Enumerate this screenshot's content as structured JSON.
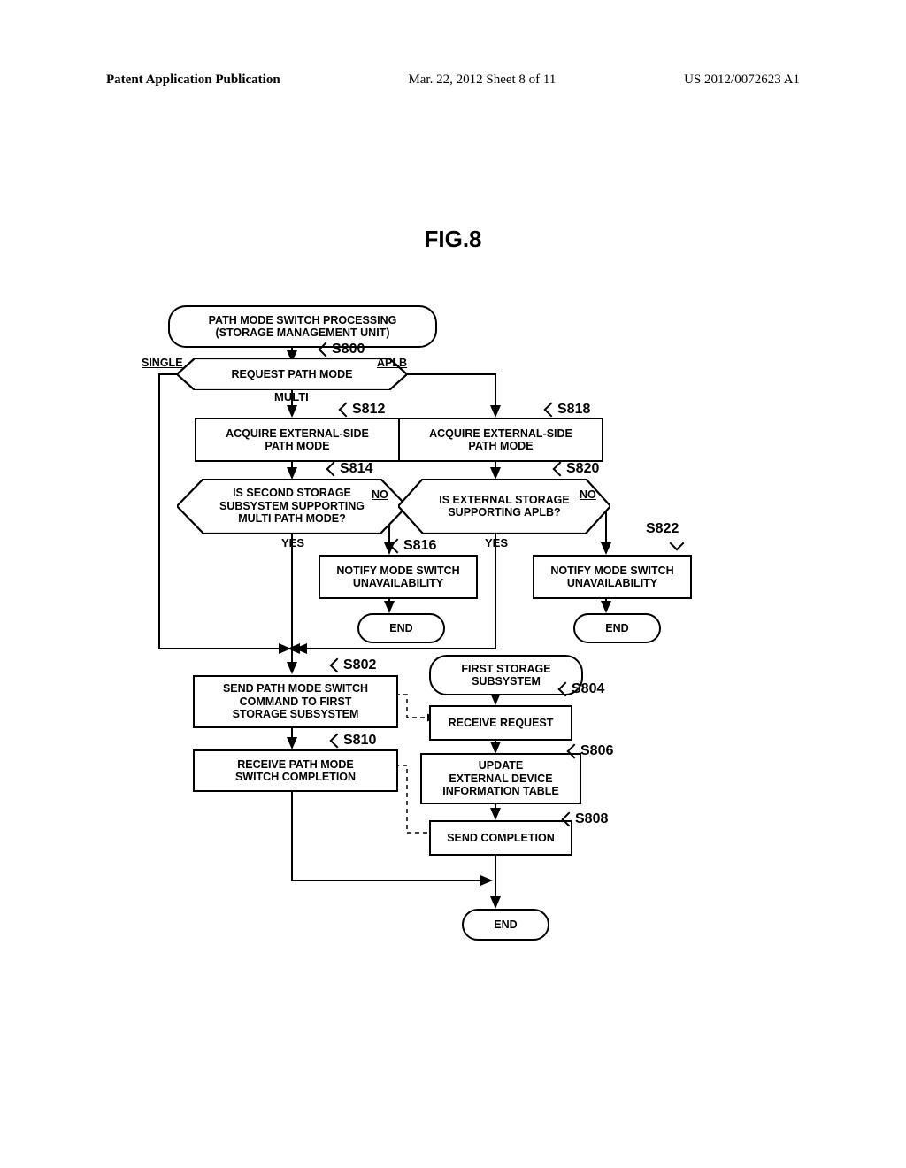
{
  "header": {
    "left": "Patent Application Publication",
    "center": "Mar. 22, 2012  Sheet 8 of 11",
    "right": "US 2012/0072623 A1"
  },
  "figure_title": "FIG.8",
  "nodes": {
    "start": "PATH MODE SWITCH PROCESSING\n(STORAGE MANAGEMENT UNIT)",
    "s800": "REQUEST PATH MODE",
    "s800lb_single": "SINGLE",
    "s800lb_multi": "MULTI",
    "s800lb_aplb": "APLB",
    "s812": "ACQUIRE EXTERNAL-SIDE\nPATH MODE",
    "s814": "IS SECOND STORAGE\nSUBSYSTEM SUPPORTING\nMULTI PATH MODE?",
    "s814yes": "YES",
    "s814no": "NO",
    "s816": "NOTIFY MODE SWITCH\nUNAVAILABILITY",
    "end1": "END",
    "s818": "ACQUIRE EXTERNAL-SIDE\nPATH MODE",
    "s820": "IS EXTERNAL STORAGE\nSUPPORTING APLB?",
    "s820yes": "YES",
    "s820no": "NO",
    "s822": "NOTIFY MODE SWITCH\nUNAVAILABILITY",
    "end2": "END",
    "s802": "SEND PATH MODE SWITCH\nCOMMAND TO FIRST\nSTORAGE SUBSYSTEM",
    "s810": "RECEIVE PATH MODE\nSWITCH COMPLETION",
    "firstss": "FIRST STORAGE\nSUBSYSTEM",
    "s804": "RECEIVE REQUEST",
    "s806": "UPDATE\nEXTERNAL DEVICE\nINFORMATION TABLE",
    "s808": "SEND COMPLETION",
    "endfinal": "END"
  },
  "steps": {
    "s800": "S800",
    "s802": "S802",
    "s804": "S804",
    "s806": "S806",
    "s808": "S808",
    "s810": "S810",
    "s812": "S812",
    "s814": "S814",
    "s816": "S816",
    "s818": "S818",
    "s820": "S820",
    "s822": "S822"
  }
}
